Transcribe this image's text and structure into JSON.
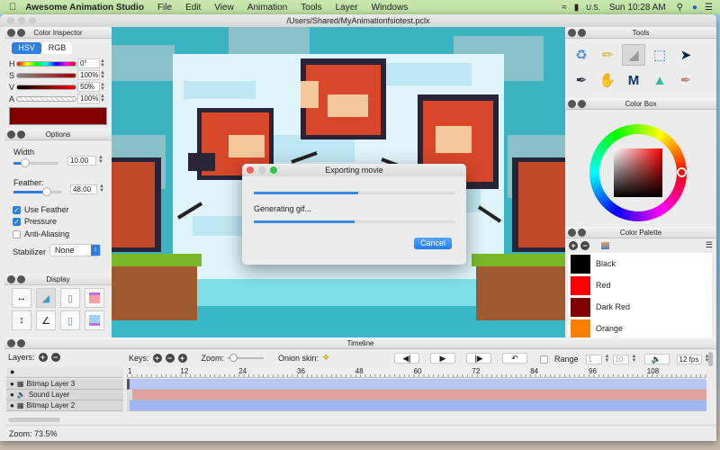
{
  "menubar": {
    "app_name": "Awesome Animation Studio",
    "items": [
      "File",
      "Edit",
      "View",
      "Animation",
      "Tools",
      "Layer",
      "Windows"
    ],
    "input_source": "U.S.",
    "clock": "Sun 10:28 AM"
  },
  "window": {
    "title": "/Users/Shared/MyAnimationfsiotest.pclx"
  },
  "color_inspector": {
    "title": "Color Inspector",
    "tabs": [
      "HSV",
      "RGB"
    ],
    "active_tab": "HSV",
    "sliders": [
      {
        "label": "H",
        "value": "0°"
      },
      {
        "label": "S",
        "value": "100%"
      },
      {
        "label": "V",
        "value": "50%"
      },
      {
        "label": "A",
        "value": "100%"
      }
    ],
    "current_color": "#800000"
  },
  "options": {
    "title": "Options",
    "width_label": "Width",
    "width_value": "10.00",
    "feather_label": "Feather:",
    "feather_value": "48.00",
    "use_feather": {
      "label": "Use Feather",
      "checked": true
    },
    "pressure": {
      "label": "Pressure",
      "checked": true
    },
    "anti_aliasing": {
      "label": "Anti-Aliasing",
      "checked": false
    },
    "stabilizer_label": "Stabilizer",
    "stabilizer_value": "None"
  },
  "display": {
    "title": "Display"
  },
  "tools": {
    "title": "Tools",
    "items": [
      "clear-icon",
      "pencil-icon",
      "eraser-icon",
      "select-icon",
      "move-icon",
      "pen-icon",
      "smudge-icon",
      "polyline-icon",
      "bucket-icon",
      "eyedropper-icon"
    ]
  },
  "color_box": {
    "title": "Color Box"
  },
  "color_palette": {
    "title": "Color Palette",
    "colors": [
      {
        "name": "Black",
        "hex": "#000000"
      },
      {
        "name": "Red",
        "hex": "#ff0000"
      },
      {
        "name": "Dark Red",
        "hex": "#800000"
      },
      {
        "name": "Orange",
        "hex": "#ff8000"
      }
    ]
  },
  "dialog": {
    "title": "Exporting movie",
    "status": "Generating gif...",
    "progress1": 0.52,
    "progress2": 0.5,
    "cancel_label": "Cancel"
  },
  "timeline": {
    "title": "Timeline",
    "layers_label": "Layers:",
    "keys_label": "Keys:",
    "zoom_label": "Zoom:",
    "onion_label": "Onion skin:",
    "range_label": "Range",
    "range_start": "1",
    "range_end": "10",
    "fps": "12 fps",
    "ruler": [
      "1",
      "12",
      "24",
      "36",
      "48",
      "60",
      "72",
      "84",
      "96",
      "108"
    ],
    "layers": [
      {
        "name": "Bitmap Layer 3",
        "type": "bitmap",
        "color": "#b7c8f7"
      },
      {
        "name": "Sound Layer",
        "type": "sound",
        "color": "#e0a0a0"
      },
      {
        "name": "Bitmap Layer 2",
        "type": "bitmap",
        "color": "#9fb4f2"
      }
    ]
  },
  "status": {
    "zoom": "Zoom: 73.5%"
  }
}
